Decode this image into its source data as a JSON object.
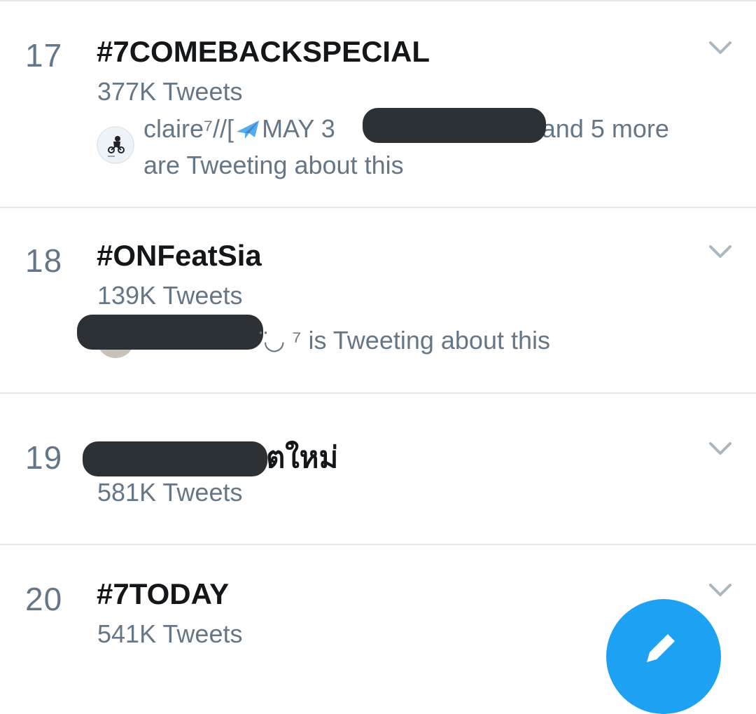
{
  "trends": [
    {
      "rank": "17",
      "title": "#7COMEBACKSPECIAL",
      "count": "377K Tweets",
      "context_line1_prefix": "claire⁷//[",
      "context_line1_mid": "MAY 3",
      "context_line1_suffix": ", and 5 more",
      "context_line2": "are Tweeting about this"
    },
    {
      "rank": "18",
      "title": "#ONFeatSia",
      "count": "139K Tweets",
      "context_line1_suffix": "̈◡ ⁷ is Tweeting about this"
    },
    {
      "rank": "19",
      "title_suffix": "ตใหม่",
      "count": "581K Tweets"
    },
    {
      "rank": "20",
      "title": "#7TODAY",
      "count": "541K Tweets"
    }
  ],
  "icons": {
    "chevron": "chevron-down-icon",
    "plane": "airplane-emoji",
    "compose": "compose-tweet-icon"
  },
  "colors": {
    "accent": "#1da1f2",
    "secondary_text": "#657786",
    "primary_text": "#14171a",
    "divider": "#e1e8ed",
    "redaction": "#2c3136"
  }
}
